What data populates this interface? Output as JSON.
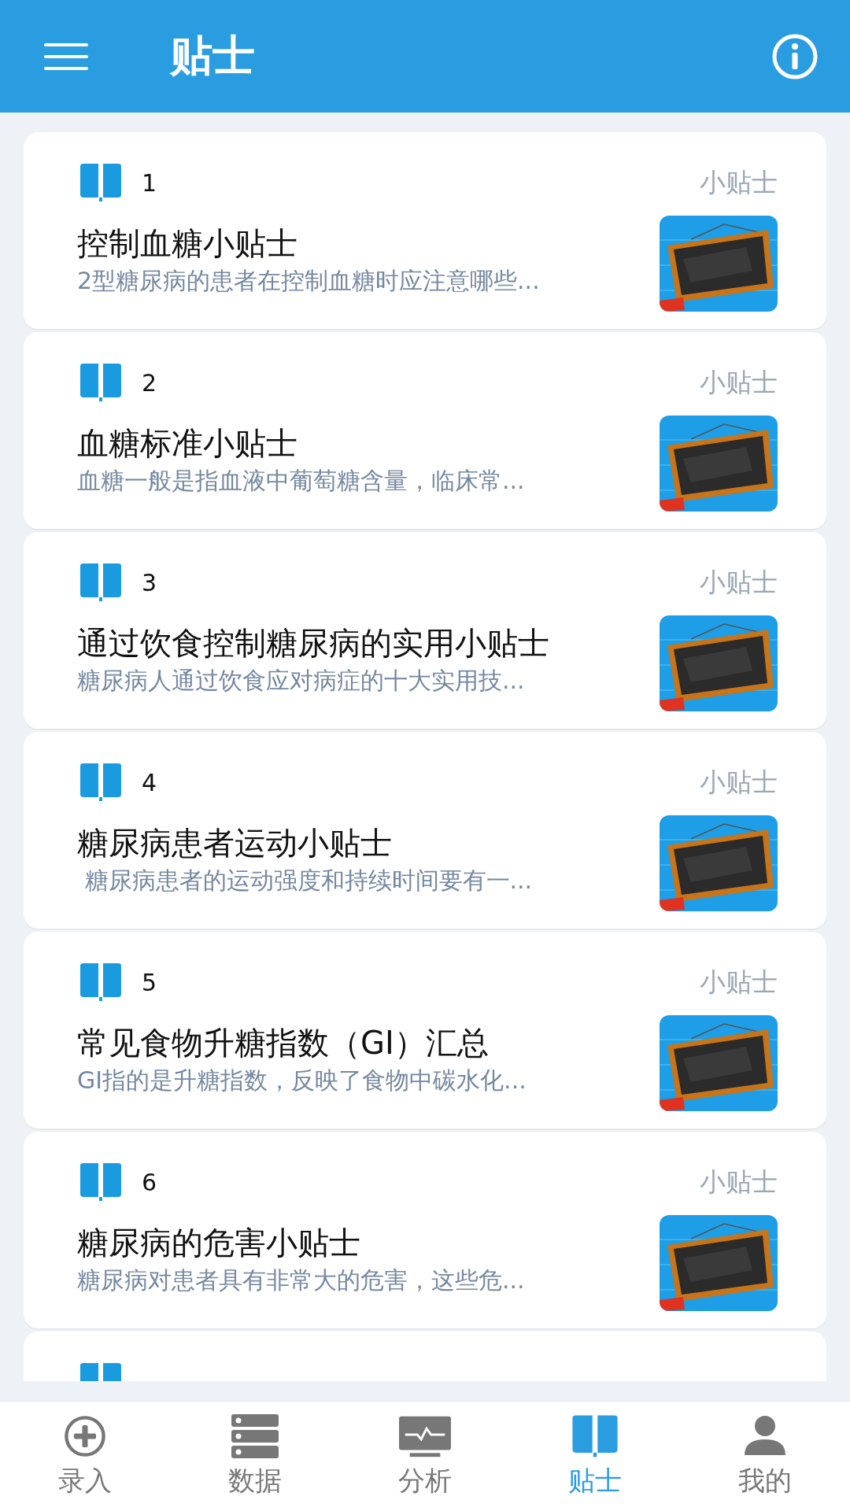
{
  "header": {
    "title": "贴士"
  },
  "tips": [
    {
      "number": "1",
      "tag": "小贴士",
      "title": "控制血糖小贴士",
      "summary": "2型糖尿病的患者在控制血糖时应注意哪些..."
    },
    {
      "number": "2",
      "tag": "小贴士",
      "title": "血糖标准小贴士",
      "summary": "血糖一般是指血液中葡萄糖含量，临床常..."
    },
    {
      "number": "3",
      "tag": "小贴士",
      "title": "通过饮食控制糖尿病的实用小贴士",
      "summary": "糖尿病人通过饮食应对病症的十大实用技..."
    },
    {
      "number": "4",
      "tag": "小贴士",
      "title": "糖尿病患者运动小贴士",
      "summary": " 糖尿病患者的运动强度和持续时间要有一..."
    },
    {
      "number": "5",
      "tag": "小贴士",
      "title": "常见食物升糖指数（GI）汇总",
      "summary": "GI指的是升糖指数，反映了食物中碳水化..."
    },
    {
      "number": "6",
      "tag": "小贴士",
      "title": "糖尿病的危害小贴士",
      "summary": "糖尿病对患者具有非常大的危害，这些危..."
    }
  ],
  "nav": [
    {
      "label": "录入",
      "selected": false
    },
    {
      "label": "数据",
      "selected": false
    },
    {
      "label": "分析",
      "selected": false
    },
    {
      "label": "贴士",
      "selected": true
    },
    {
      "label": "我的",
      "selected": false
    }
  ]
}
